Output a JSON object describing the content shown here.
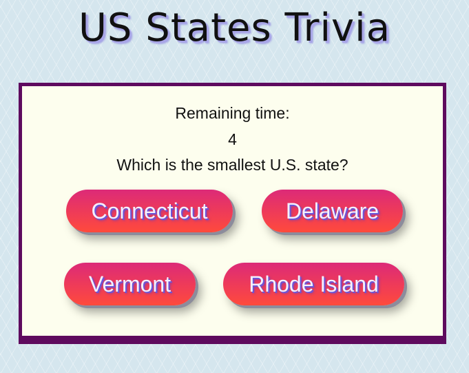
{
  "title": "US States Trivia",
  "timer": {
    "label": "Remaining time:",
    "value": "4"
  },
  "question": "Which is the smallest U.S. state?",
  "answers": [
    {
      "label": "Connecticut"
    },
    {
      "label": "Delaware"
    },
    {
      "label": "Vermont"
    },
    {
      "label": "Rhode Island"
    }
  ],
  "colors": {
    "background": "#d5e6ee",
    "panel": "#fdfeee",
    "panel_border": "#5e0a5e",
    "button_gradient_top": "#dc2a78",
    "button_gradient_bottom": "#ff4a3c",
    "button_text": "#f4f0ff",
    "text_shadow": "#6a55d8"
  }
}
